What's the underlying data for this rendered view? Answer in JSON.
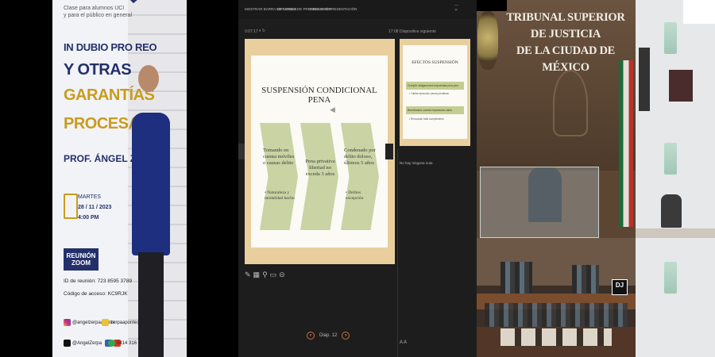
{
  "poster": {
    "tagline": "Clase para alumnos UCI\ny para el público en general",
    "title_line1": "IN DUBIO PRO REO",
    "title_line2": "Y OTRAS",
    "title_line3": "GARANTÍAS",
    "title_line4": "PROCESALES",
    "professor": "PROF. ÁNGEL ZERPA",
    "day": "MARTES",
    "date": "28 / 11 / 2023",
    "time": "4:00 PM",
    "zoom_label": "REUNIÓN ZOOM",
    "meeting_id": "ID de reunión: 723 8595 3789",
    "access_code": "Código de acceso: KC9RJK",
    "social": {
      "instagram": "@angelzerpaaponte",
      "email": "zerpaaponte@yahoo.es",
      "twitter": "@AngelZerpa",
      "phone": "0414 316 19 40"
    }
  },
  "presenter": {
    "menu": [
      "MOSTRAR BARRA DE TAREAS",
      "OPCIONES DE PRESENTACIÓN",
      "FINALIZAR PRESENTACIÓN"
    ],
    "timer": "0:07:17",
    "clock": "17:08",
    "next_slide_label": "Diapositiva siguiente",
    "current_slide": {
      "title": "SUSPENSIÓN CONDICIONAL PENA",
      "col1_text": "Tomando en cuenta móviles o causas delito",
      "col1_bullet": "• Naturaleza y modalidad hecho",
      "col2_text": "Pena privativa libertad no exceda 3 años",
      "col3_text": "Condenado por delito doloso, últimos 5 años",
      "col3_bullet": "• Delitos excepción"
    },
    "next_slide": {
      "title": "EFECTOS SUSPENSIÓN",
      "bar1": "Cumplir obligaciones impuestas proc pen",
      "bullet1": "• Tutelar ejecución penas privativas",
      "bar2": "Beneficiario cubrirá reparación daño",
      "bullet2": "• Revocada, falta cumplimiento"
    },
    "notes": "No hay ninguna nota",
    "slide_counter": "Diap. 12"
  },
  "court": {
    "title_line1": "TRIBUNAL SUPERIOR",
    "title_line2": "DE JUSTICIA",
    "title_line3": "DE LA CIUDAD DE MÉXICO",
    "badge": "DJ"
  }
}
